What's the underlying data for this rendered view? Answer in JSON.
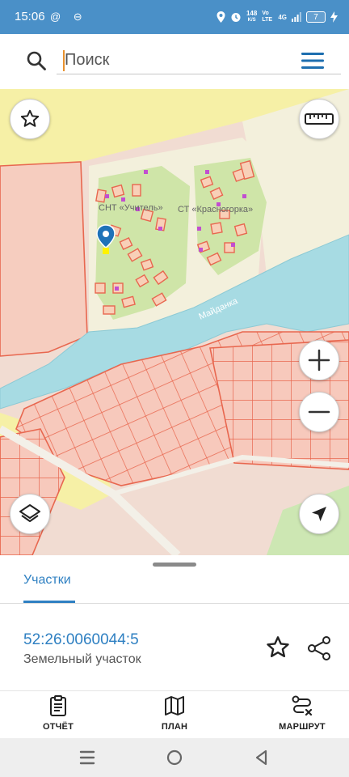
{
  "status_bar": {
    "time": "15:06",
    "left_icons": "@ ⊖",
    "speed_value": "148",
    "speed_unit": "K/S",
    "network_a": "Vo LTE",
    "network_b": "4G",
    "battery": "7"
  },
  "search": {
    "placeholder": "Поиск"
  },
  "map": {
    "labels": {
      "snt": "СНТ «Учитель»",
      "st": "СТ «Красногорка»",
      "river": "Майданка"
    },
    "colors": {
      "land_base": "#f1dcd2",
      "cadastral_fill": "#f6c5b8",
      "cadastral_line": "#e8674f",
      "river": "#a7dbe3",
      "forest": "#cde7b3",
      "yellow_zone": "#f6f0a6",
      "pin": "#1e72b8"
    }
  },
  "sheet": {
    "tab_label": "Участки",
    "parcel_number": "52:26:0060044:5",
    "parcel_type": "Земельный участок"
  },
  "actions": {
    "report": "ОТЧЁТ",
    "plan": "ПЛАН",
    "route": "МАРШРУТ"
  }
}
